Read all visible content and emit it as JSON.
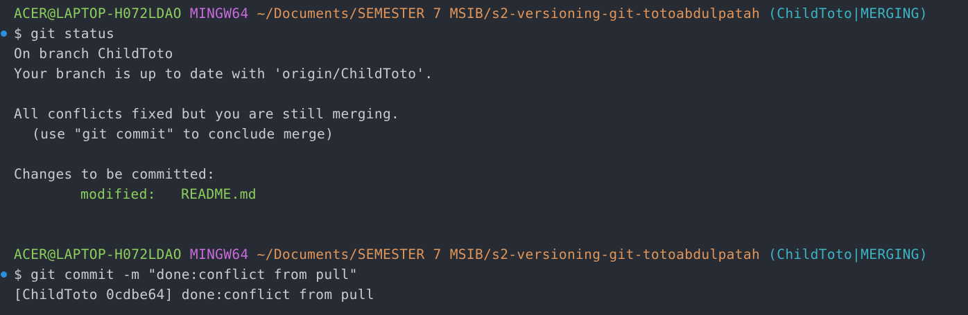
{
  "prompt": {
    "user_host": "ACER@LAPTOP-H072LDAO",
    "system": "MINGW64",
    "path": "~/Documents/SEMESTER 7 MSIB/s2-versioning-git-totoabdulpatah",
    "branch_open": "(ChildToto",
    "separator": "|",
    "state_close": "MERGING)"
  },
  "blocks": [
    {
      "command": "$ git status",
      "output": [
        "On branch ChildToto",
        "Your branch is up to date with 'origin/ChildToto'.",
        "",
        "All conflicts fixed but you are still merging.",
        "(use \"git commit\" to conclude merge)",
        "",
        "Changes to be committed:",
        "modified:   README.md"
      ]
    },
    {
      "command": "$ git commit -m \"done:conflict from pull\"",
      "output": [
        "[ChildToto 0cdbe64] done:conflict from pull"
      ]
    }
  ],
  "colors": {
    "background": "#272b33",
    "text": "#c9ccd2",
    "user_host": "#8ccf5e",
    "system": "#c86bdc",
    "path": "#e0955a",
    "branch": "#3cb4c4",
    "command_marker": "#2b90d9"
  }
}
